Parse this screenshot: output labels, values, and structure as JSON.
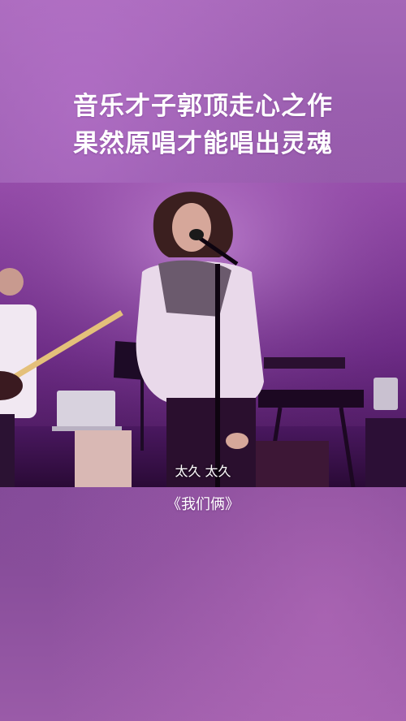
{
  "headline": {
    "line1": "音乐才子郭顶走心之作",
    "line2": "果然原唱才能唱出灵魂"
  },
  "video": {
    "subtitle": "太久 太久"
  },
  "song": {
    "title": "《我们俩》"
  },
  "colors": {
    "background": "#8a4f9f",
    "stage_purple": "#9a4fae",
    "text": "#ffffff"
  }
}
